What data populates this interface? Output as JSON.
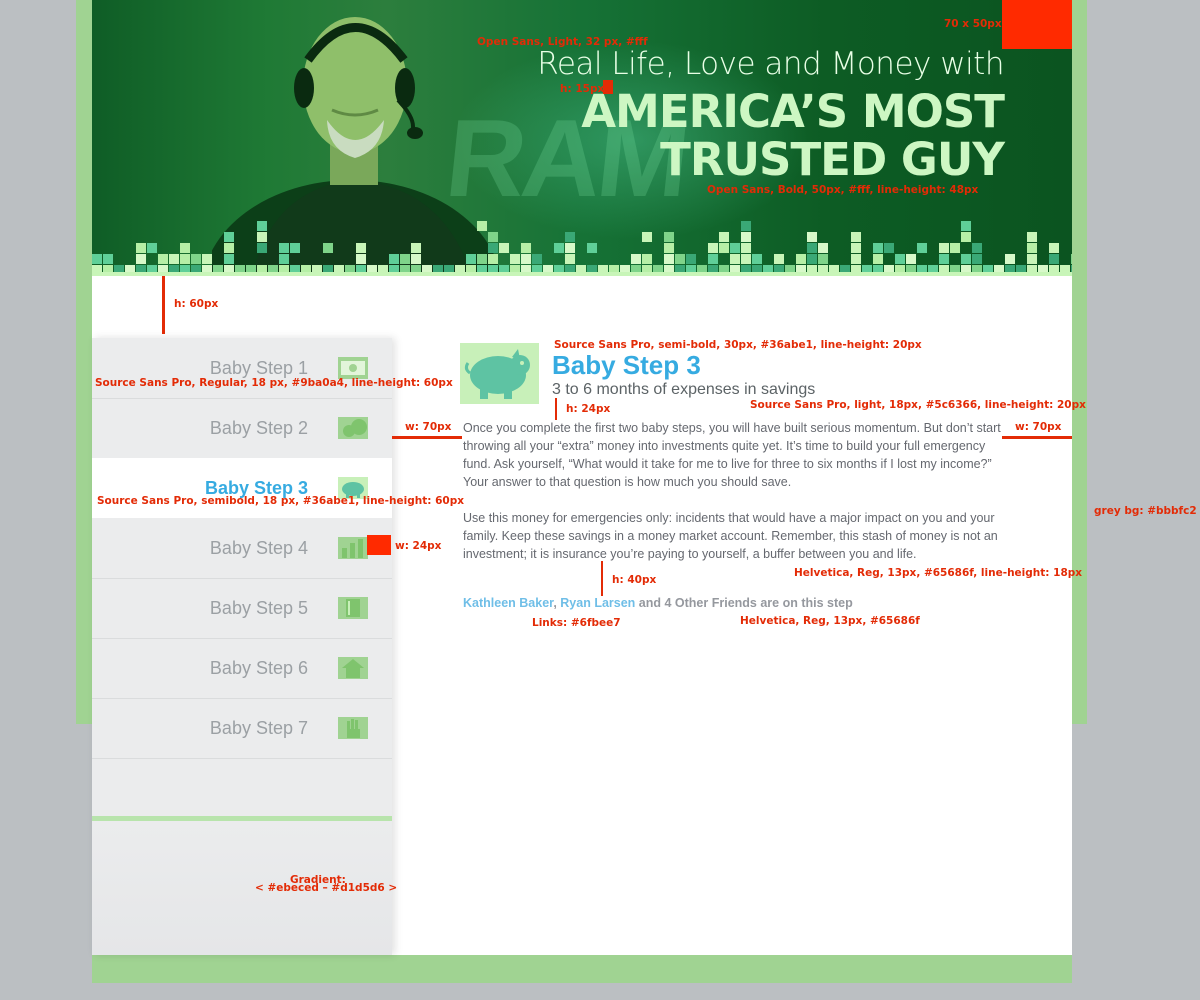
{
  "hero": {
    "title_line1": "Real Life, Love and Money with",
    "title_line2": "AMERICA’S MOST",
    "title_line3": "TRUSTED GUY",
    "ghost_text": "RAM"
  },
  "sidebar": {
    "items": [
      {
        "label": "Baby Step 1",
        "icon": "money-icon"
      },
      {
        "label": "Baby Step 2",
        "icon": "snowball-icon"
      },
      {
        "label": "Baby Step 3",
        "icon": "piggy-bank-icon",
        "active": true
      },
      {
        "label": "Baby Step 4",
        "icon": "bar-chart-icon"
      },
      {
        "label": "Baby Step 5",
        "icon": "book-icon"
      },
      {
        "label": "Baby Step 6",
        "icon": "house-icon"
      },
      {
        "label": "Baby Step 7",
        "icon": "hand-icon"
      }
    ]
  },
  "content": {
    "title": "Baby Step 3",
    "subtitle": "3 to 6 months of expenses in savings",
    "paragraph1": "Once you complete the first two baby steps, you will have built serious momentum. But don’t start throwing all your “extra” money into investments quite yet. It’s time to build your full emergency fund. Ask yourself, “What would it take for me to live for three to six months if I lost my income?” Your answer to that question is how much you should save.",
    "paragraph2": "Use this money for emergencies only: incidents that would have a major impact on you and your family. Keep these savings in a money market account. Remember, this stash of money is not an investment; it is insurance you’re paying to yourself, a buffer between you and life.",
    "friend1": "Kathleen Baker",
    "friend_sep": ", ",
    "friend2": "Ryan Larsen",
    "friends_suffix": " and 4 Other Friends are on this step"
  },
  "annotations": {
    "box_size": "70 x 50px",
    "hero_font1": "Open Sans, Light, 32 px, #fff",
    "h15": "h: 15px",
    "hero_font2": "Open Sans, Bold, 50px, #fff, line-height: 48px",
    "h60": "h: 60px",
    "sidebar_font": "Source Sans Pro, Regular, 18 px, #9ba0a4, line-height: 60px",
    "title_font": "Source Sans Pro, semi-bold, 30px, #36abe1, line-height: 20px",
    "sub_font": "Source Sans Pro, light, 18px, #5c6366, line-height: 20px",
    "h24": "h: 24px",
    "w70_left": "w: 70px",
    "w70_right": "w: 70px",
    "active_font": "Source Sans Pro, semibold, 18 px, #36abe1, line-height: 60px",
    "w24": "w: 24px",
    "grey_bg": "grey bg: #bbbfc2",
    "body_font": "Helvetica, Reg, 13px, #65686f, line-height: 18px",
    "h40": "h: 40px",
    "links": "Links: #6fbee7",
    "friends_font": "Helvetica, Reg, 13px, #65686f",
    "gradient1": "Gradient:",
    "gradient2": "< #ebeced – #d1d5d6 >"
  },
  "colors": {
    "accent_blue": "#36abe1",
    "link": "#6fbee7",
    "body_text": "#65686f",
    "sidebar_text": "#9ba0a4",
    "grey_bg": "#bbbfc2",
    "annotation_red": "#e32b06",
    "frame_green": "#a0d392"
  }
}
